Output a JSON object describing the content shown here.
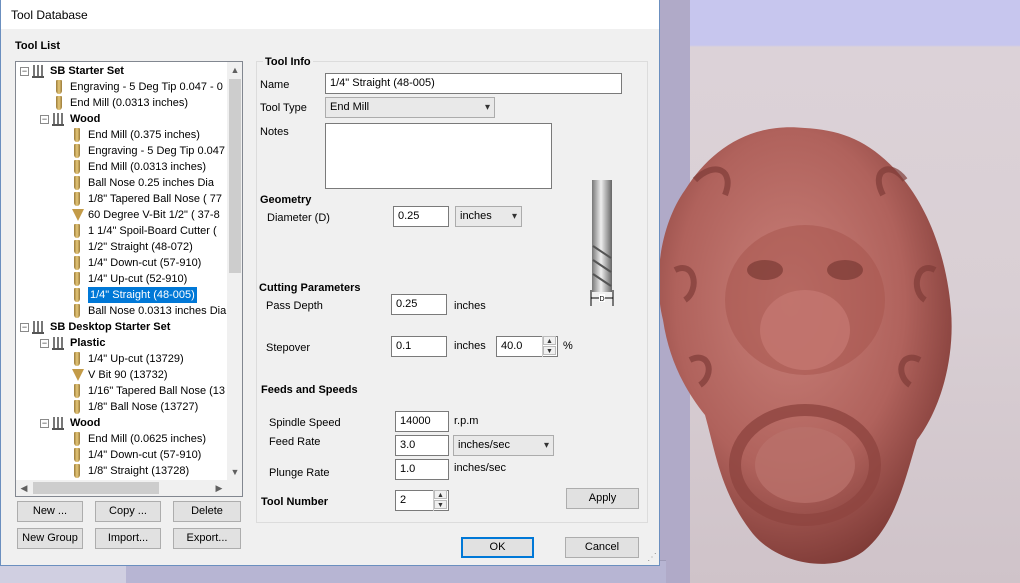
{
  "window": {
    "title": "Tool Database"
  },
  "tool_list": {
    "title": "Tool List",
    "rows": [
      {
        "label": "SB Starter Set",
        "kind": "group",
        "level": 0
      },
      {
        "label": "Engraving - 5 Deg Tip 0.047 - 0",
        "kind": "tool",
        "level": 1
      },
      {
        "label": "End Mill (0.0313 inches)",
        "kind": "tool",
        "level": 1
      },
      {
        "label": "Wood",
        "kind": "group",
        "level": 1
      },
      {
        "label": "End Mill (0.375 inches)",
        "kind": "tool",
        "level": 2
      },
      {
        "label": "Engraving - 5 Deg Tip 0.047",
        "kind": "tool",
        "level": 2
      },
      {
        "label": "End Mill (0.0313 inches)",
        "kind": "tool",
        "level": 2
      },
      {
        "label": "Ball Nose 0.25 inches Dia",
        "kind": "tool",
        "level": 2
      },
      {
        "label": "1/8\" Tapered Ball Nose ( 77",
        "kind": "tool",
        "level": 2
      },
      {
        "label": "60 Degree V-Bit 1/2\"  ( 37-8",
        "kind": "vbit",
        "level": 2
      },
      {
        "label": "1 1/4\" Spoil-Board Cutter (",
        "kind": "tool",
        "level": 2
      },
      {
        "label": "1/2\" Straight  (48-072)",
        "kind": "tool",
        "level": 2
      },
      {
        "label": "1/4\"  Down-cut (57-910)",
        "kind": "tool",
        "level": 2
      },
      {
        "label": "1/4\" Up-cut (52-910)",
        "kind": "tool",
        "level": 2
      },
      {
        "label": "1/4\" Straight  (48-005)",
        "kind": "tool",
        "level": 2,
        "selected": true
      },
      {
        "label": "Ball Nose 0.0313 inches Dia",
        "kind": "tool",
        "level": 2
      },
      {
        "label": "SB Desktop Starter Set",
        "kind": "group",
        "level": 0
      },
      {
        "label": "Plastic",
        "kind": "group",
        "level": 1
      },
      {
        "label": "1/4\" Up-cut (13729)",
        "kind": "tool",
        "level": 2
      },
      {
        "label": "V Bit 90 (13732)",
        "kind": "vbit",
        "level": 2
      },
      {
        "label": "1/16\" Tapered Ball Nose (13",
        "kind": "tool",
        "level": 2
      },
      {
        "label": "1/8\" Ball Nose (13727)",
        "kind": "tool",
        "level": 2
      },
      {
        "label": "Wood",
        "kind": "group",
        "level": 1
      },
      {
        "label": "End Mill (0.0625 inches)",
        "kind": "tool",
        "level": 2
      },
      {
        "label": "1/4\"  Down-cut (57-910)",
        "kind": "tool",
        "level": 2
      },
      {
        "label": "1/8\" Straight (13728)",
        "kind": "tool",
        "level": 2
      }
    ],
    "buttons": {
      "new": "New ...",
      "copy": "Copy ...",
      "delete": "Delete",
      "new_group": "New Group",
      "import": "Import...",
      "export": "Export..."
    }
  },
  "tool_info": {
    "title": "Tool Info",
    "name_label": "Name",
    "name_value": "1/4\" Straight  (48-005)",
    "type_label": "Tool Type",
    "type_value": "End Mill",
    "notes_label": "Notes",
    "notes_value": ""
  },
  "geometry": {
    "title": "Geometry",
    "diameter_label": "Diameter (D)",
    "diameter_value": "0.25",
    "units_value": "inches"
  },
  "cutting": {
    "title": "Cutting Parameters",
    "pass_depth_label": "Pass Depth",
    "pass_depth_value": "0.25",
    "pass_depth_unit": "inches",
    "stepover_label": "Stepover",
    "stepover_value": "0.1",
    "stepover_unit": "inches",
    "stepover_pct_value": "40.0",
    "stepover_pct_unit": "%"
  },
  "feeds": {
    "title": "Feeds and Speeds",
    "spindle_label": "Spindle Speed",
    "spindle_value": "14000",
    "spindle_unit": "r.p.m",
    "feed_label": "Feed Rate",
    "feed_value": "3.0",
    "feed_unit": "inches/sec",
    "plunge_label": "Plunge Rate",
    "plunge_value": "1.0",
    "plunge_unit": "inches/sec"
  },
  "tool_number": {
    "label": "Tool Number",
    "value": "2"
  },
  "actions": {
    "apply": "Apply",
    "ok": "OK",
    "cancel": "Cancel"
  },
  "diagram": {
    "dimension_label": "D"
  },
  "colors": {
    "selection": "#0078d7",
    "model": "#b66a63",
    "dialog_bg": "#f0f0f0"
  },
  "icons": [
    "tool-bit-icon",
    "vbit-icon",
    "tool-group-icon",
    "expand-icon",
    "spin-up-icon",
    "spin-down-icon",
    "dropdown-chevron-icon"
  ]
}
